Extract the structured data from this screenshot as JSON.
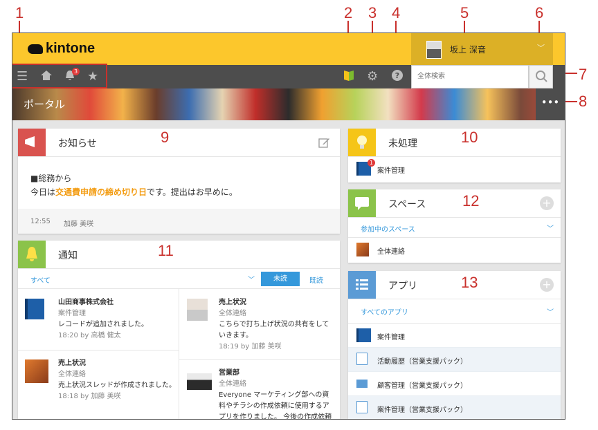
{
  "callouts": [
    "1",
    "2",
    "3",
    "4",
    "5",
    "6",
    "7",
    "8",
    "9",
    "10",
    "11",
    "12",
    "13"
  ],
  "header": {
    "logo_text": "kintone",
    "user_name": "坂上 深音",
    "user_caret": "﹀",
    "notification_count": "3",
    "search_placeholder": "全体検索"
  },
  "banner": {
    "title": "ポータル",
    "more": "•••"
  },
  "announcement": {
    "title": "お知らせ",
    "line1": "■総務から",
    "line2_prefix": "今日は",
    "line2_highlight": "交通費申請の締め切り日",
    "line2_suffix": "です。提出はお早めに。",
    "time": "12:55",
    "author": "加藤 美咲"
  },
  "notifications": {
    "title": "通知",
    "filter_all": "すべて",
    "tab_unread": "未読",
    "tab_read": "既読",
    "items": [
      {
        "title": "山田商事株式会社",
        "sub": "案件管理",
        "body": "レコードが追加されました。",
        "meta": "18:20  by 高橋 健太"
      },
      {
        "title": "売上状況",
        "sub": "全体連絡",
        "body": "こちらで打ち上げ状況の共有をしていきます。",
        "meta": "18:19  by 加藤 美咲"
      },
      {
        "title": "売上状況",
        "sub": "全体連絡",
        "body": "売上状況スレッドが作成されました。",
        "meta": "18:18  by 加藤 美咲"
      },
      {
        "title": "営業部",
        "sub": "全体連絡",
        "body": "Everyone マーケティング部への資料やチラシの作成依頼に使用するアプリを作りました。 今後の作成依頼に",
        "meta": ""
      }
    ]
  },
  "pending": {
    "title": "未処理",
    "badge": "1",
    "item": "案件管理"
  },
  "spaces": {
    "title": "スペース",
    "filter": "参加中のスペース",
    "item": "全体連絡",
    "plus": "+"
  },
  "apps": {
    "title": "アプリ",
    "filter": "すべてのアプリ",
    "plus": "+",
    "items": [
      "案件管理",
      "活動履歴（営業支援パック）",
      "顧客管理（営業支援パック）",
      "案件管理（営業支援パック）"
    ]
  },
  "colors": {
    "header_yellow": "#fcc72c",
    "toolbar": "#4d4d4d",
    "accent_blue": "#3498db",
    "highlight_orange": "#f39c12",
    "callout_red": "#c9302c"
  }
}
